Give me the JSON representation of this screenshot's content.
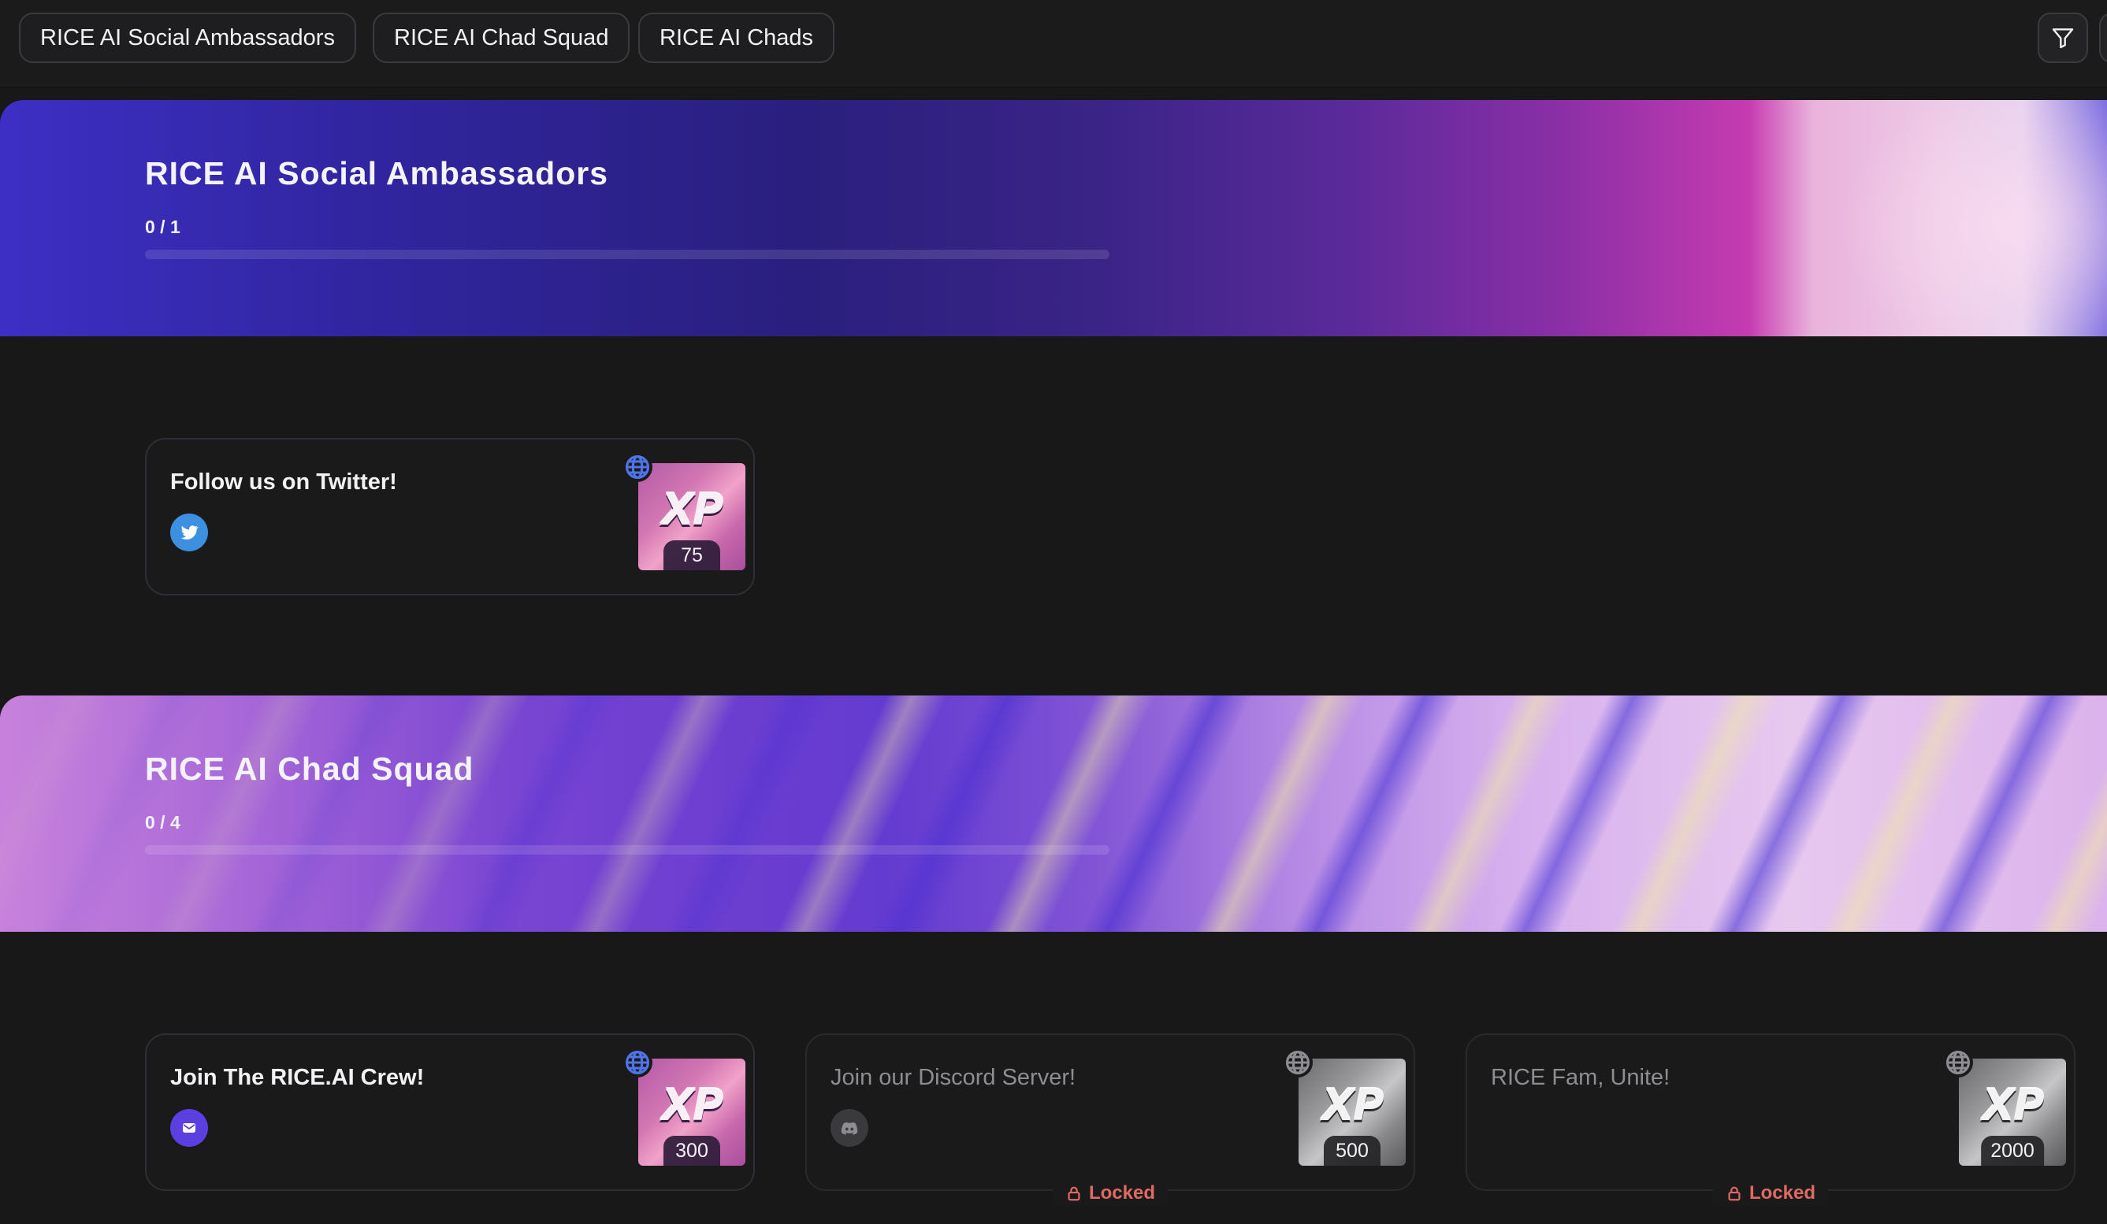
{
  "filters": {
    "chips": [
      {
        "label": "RICE AI Social Ambassadors"
      },
      {
        "label": "RICE AI Chad Squad"
      },
      {
        "label": "RICE AI Chads"
      }
    ],
    "filter_icon": "filter-funnel-icon"
  },
  "sections": [
    {
      "title": "RICE AI Social Ambassadors",
      "progress_text": "0 / 1",
      "progress_fraction": 0,
      "quests": [
        {
          "title": "Follow us on Twitter!",
          "platform_icon": "twitter-icon",
          "xp": "75",
          "locked": false
        }
      ]
    },
    {
      "title": "RICE AI Chad Squad",
      "progress_text": "0 / 4",
      "progress_fraction": 0,
      "quests": [
        {
          "title": "Join The RICE.AI Crew!",
          "platform_icon": "email-icon",
          "xp": "300",
          "locked": false
        },
        {
          "title": "Join our Discord Server!",
          "platform_icon": "discord-icon",
          "xp": "500",
          "locked": true,
          "locked_label": "Locked"
        },
        {
          "title": "RICE Fam, Unite!",
          "xp": "2000",
          "locked": true,
          "locked_label": "Locked"
        }
      ]
    }
  ],
  "xp_badge_text": "XP",
  "colors": {
    "background": "#181819",
    "twitter": "#3d8fe0",
    "email": "#5b3fe0",
    "globe_active": "#4f74e8",
    "locked": "#e06a63"
  }
}
